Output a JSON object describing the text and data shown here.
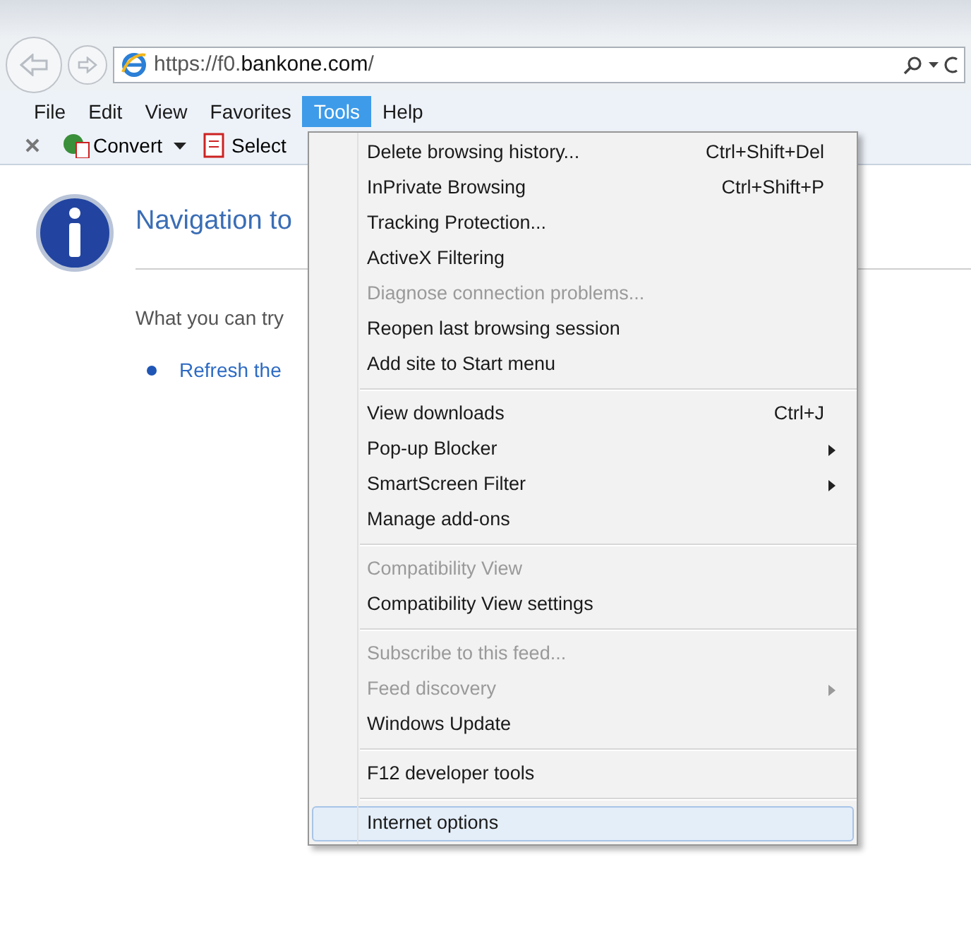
{
  "address_bar": {
    "url_prefix": "https://f0.",
    "url_domain": "bankone.com",
    "url_suffix": "/"
  },
  "menu_bar": [
    {
      "label": "File",
      "selected": false
    },
    {
      "label": "Edit",
      "selected": false
    },
    {
      "label": "View",
      "selected": false
    },
    {
      "label": "Favorites",
      "selected": false
    },
    {
      "label": "Tools",
      "selected": true
    },
    {
      "label": "Help",
      "selected": false
    }
  ],
  "toolbar": {
    "convert": "Convert",
    "select": "Select"
  },
  "page": {
    "title": "Navigation to",
    "hint": "What you can try",
    "link": "Refresh the"
  },
  "tools_menu": [
    [
      {
        "label": "Delete browsing history...",
        "shortcut": "Ctrl+Shift+Del",
        "disabled": false,
        "submenu": false,
        "selected": false
      },
      {
        "label": "InPrivate Browsing",
        "shortcut": "Ctrl+Shift+P",
        "disabled": false,
        "submenu": false,
        "selected": false
      },
      {
        "label": "Tracking Protection...",
        "disabled": false,
        "submenu": false,
        "selected": false
      },
      {
        "label": "ActiveX Filtering",
        "disabled": false,
        "submenu": false,
        "selected": false
      },
      {
        "label": "Diagnose connection problems...",
        "disabled": true,
        "submenu": false,
        "selected": false
      },
      {
        "label": "Reopen last browsing session",
        "disabled": false,
        "submenu": false,
        "selected": false
      },
      {
        "label": "Add site to Start menu",
        "disabled": false,
        "submenu": false,
        "selected": false
      }
    ],
    [
      {
        "label": "View downloads",
        "shortcut": "Ctrl+J",
        "disabled": false,
        "submenu": false,
        "selected": false
      },
      {
        "label": "Pop-up Blocker",
        "disabled": false,
        "submenu": true,
        "selected": false
      },
      {
        "label": "SmartScreen Filter",
        "disabled": false,
        "submenu": true,
        "selected": false
      },
      {
        "label": "Manage add-ons",
        "disabled": false,
        "submenu": false,
        "selected": false
      }
    ],
    [
      {
        "label": "Compatibility View",
        "disabled": true,
        "submenu": false,
        "selected": false
      },
      {
        "label": "Compatibility View settings",
        "disabled": false,
        "submenu": false,
        "selected": false
      }
    ],
    [
      {
        "label": "Subscribe to this feed...",
        "disabled": true,
        "submenu": false,
        "selected": false
      },
      {
        "label": "Feed discovery",
        "disabled": true,
        "submenu": true,
        "selected": false
      },
      {
        "label": "Windows Update",
        "disabled": false,
        "submenu": false,
        "selected": false
      }
    ],
    [
      {
        "label": "F12 developer tools",
        "disabled": false,
        "submenu": false,
        "selected": false
      }
    ],
    [
      {
        "label": "Internet options",
        "disabled": false,
        "submenu": false,
        "selected": true
      }
    ]
  ]
}
